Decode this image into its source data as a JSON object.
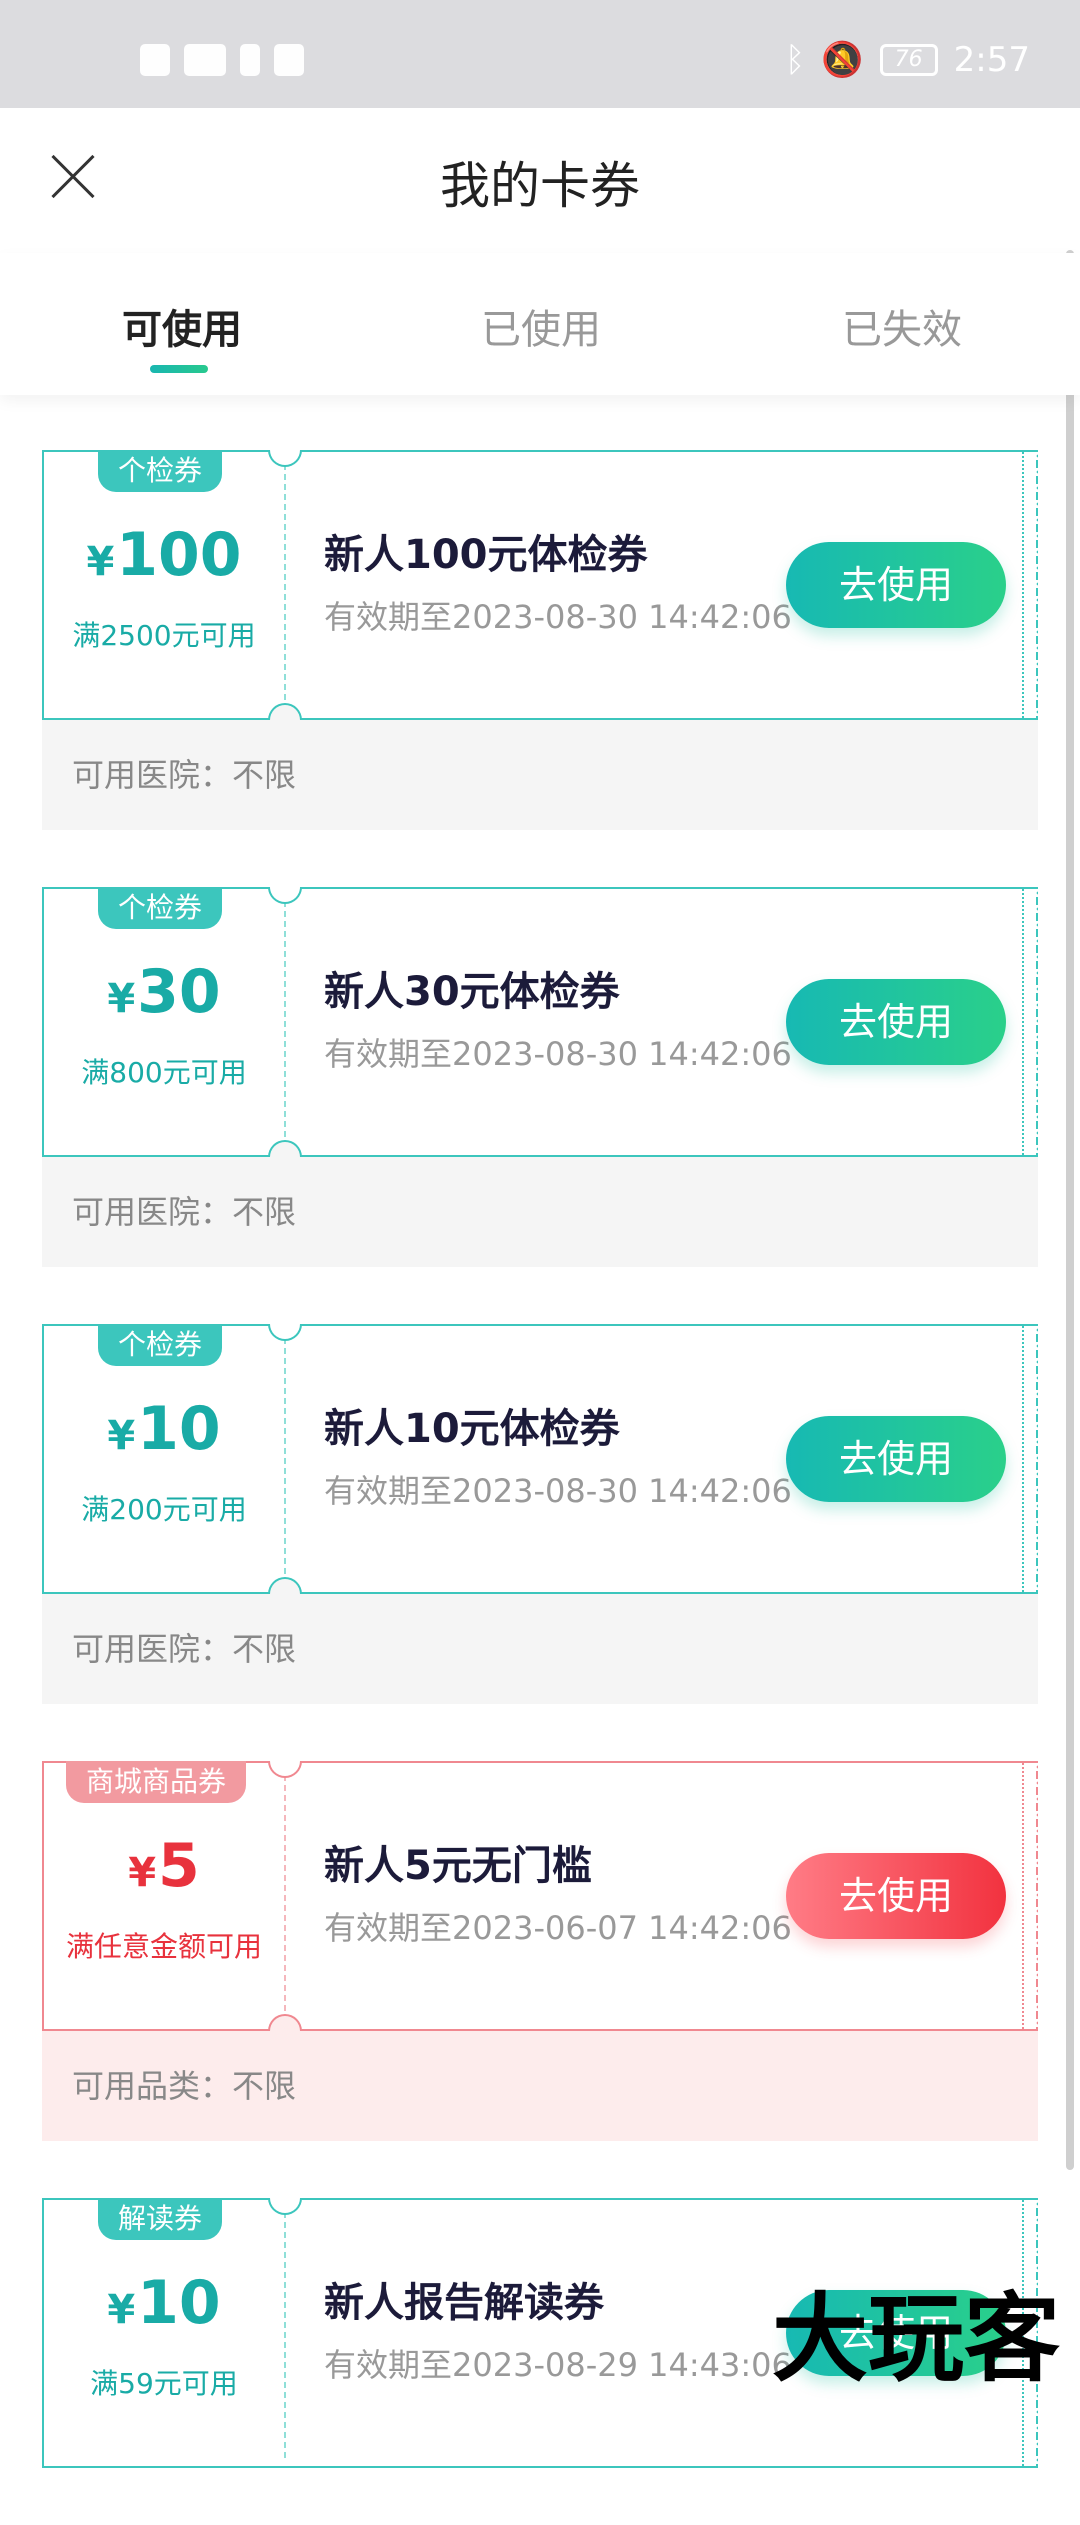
{
  "status_bar": {
    "time": "2:57",
    "battery": "76"
  },
  "header": {
    "title": "我的卡券"
  },
  "tabs": [
    "可使用",
    "已使用",
    "已失效"
  ],
  "coupons": [
    {
      "tag": "个检券",
      "currency": "¥",
      "amount": "100",
      "condition": "满2500元可用",
      "name": "新人100元体检券",
      "validity": "有效期至2023-08-30 14:42:06",
      "button": "去使用",
      "footer": "可用医院：不限"
    },
    {
      "tag": "个检券",
      "currency": "¥",
      "amount": "30",
      "condition": "满800元可用",
      "name": "新人30元体检券",
      "validity": "有效期至2023-08-30 14:42:06",
      "button": "去使用",
      "footer": "可用医院：不限"
    },
    {
      "tag": "个检券",
      "currency": "¥",
      "amount": "10",
      "condition": "满200元可用",
      "name": "新人10元体检券",
      "validity": "有效期至2023-08-30 14:42:06",
      "button": "去使用",
      "footer": "可用医院：不限"
    },
    {
      "tag": "商城商品券",
      "currency": "¥",
      "amount": "5",
      "condition": "满任意金额可用",
      "name": "新人5元无门槛",
      "validity": "有效期至2023-06-07 14:42:06",
      "button": "去使用",
      "footer": "可用品类：不限"
    },
    {
      "tag": "解读券",
      "currency": "¥",
      "amount": "10",
      "condition": "满59元可用",
      "name": "新人报告解读券",
      "validity": "有效期至2023-08-29 14:43:06",
      "button": "去使用",
      "footer": ""
    }
  ],
  "watermark": "大玩客",
  "colors": {
    "teal": "#19aba6",
    "red": "#e8323d"
  }
}
